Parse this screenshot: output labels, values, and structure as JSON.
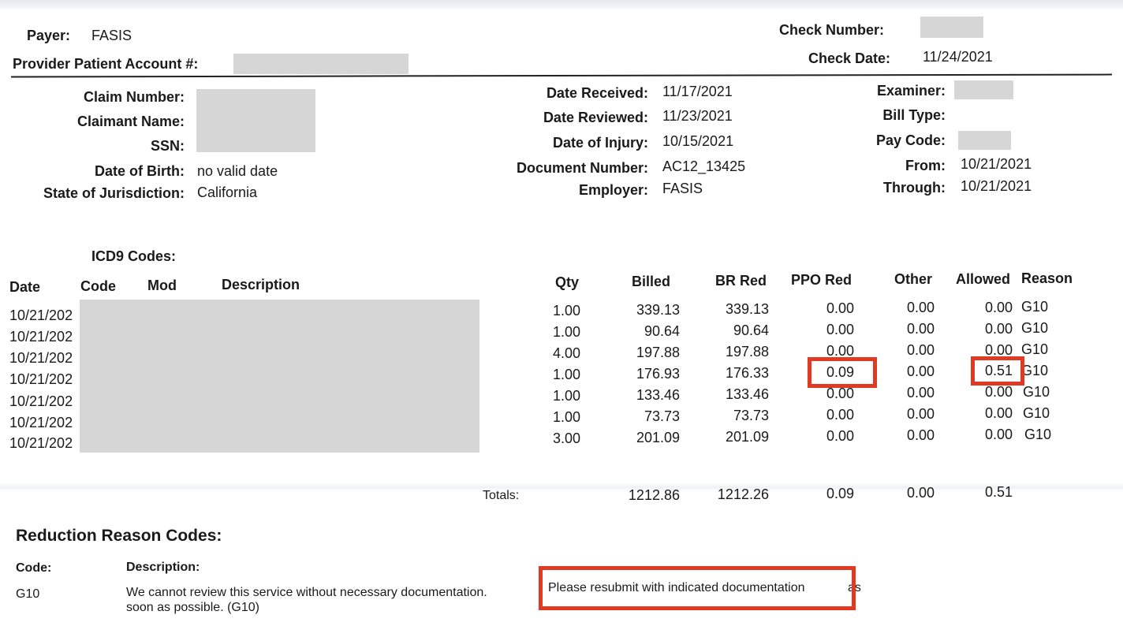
{
  "header": {
    "payer_label": "Payer:",
    "payer_value": "FASIS",
    "ppa_label": "Provider Patient Account #:",
    "check_number_label": "Check Number:",
    "check_date_label": "Check Date:",
    "check_date_value": "11/24/2021"
  },
  "claim_left": [
    {
      "label": "Claim Number:",
      "value": ""
    },
    {
      "label": "Claimant Name:",
      "value": ""
    },
    {
      "label": "SSN:",
      "value": ""
    },
    {
      "label": "Date of Birth:",
      "value": "no valid date"
    },
    {
      "label": "State of Jurisdiction:",
      "value": "California"
    }
  ],
  "claim_mid": [
    {
      "label": "Date Received:",
      "value": "11/17/2021"
    },
    {
      "label": "Date Reviewed:",
      "value": "11/23/2021"
    },
    {
      "label": "Date of Injury:",
      "value": "10/15/2021"
    },
    {
      "label": "Document Number:",
      "value": "AC12_13425"
    },
    {
      "label": "Employer:",
      "value": "FASIS"
    }
  ],
  "claim_right": [
    {
      "label": "Examiner:",
      "value": ""
    },
    {
      "label": "Bill Type:",
      "value": ""
    },
    {
      "label": "Pay Code:",
      "value": ""
    },
    {
      "label": "From:",
      "value": "10/21/2021"
    },
    {
      "label": "Through:",
      "value": "10/21/2021"
    }
  ],
  "icd_label": "ICD9 Codes:",
  "columns_left": [
    "Date",
    "Code",
    "Mod",
    "Description"
  ],
  "columns_right": [
    "Qty",
    "Billed",
    "BR Red",
    "PPO Red",
    "Other",
    "Allowed",
    "Reason"
  ],
  "rows": [
    {
      "date": "10/21/202",
      "qty": "1.00",
      "billed": "339.13",
      "br_red": "339.13",
      "ppo_red": "0.00",
      "other": "0.00",
      "allowed": "0.00",
      "reason": "G10"
    },
    {
      "date": "10/21/202",
      "qty": "1.00",
      "billed": "90.64",
      "br_red": "90.64",
      "ppo_red": "0.00",
      "other": "0.00",
      "allowed": "0.00",
      "reason": "G10"
    },
    {
      "date": "10/21/202",
      "qty": "4.00",
      "billed": "197.88",
      "br_red": "197.88",
      "ppo_red": "0.00",
      "other": "0.00",
      "allowed": "0.00",
      "reason": "G10"
    },
    {
      "date": "10/21/202",
      "qty": "1.00",
      "billed": "176.93",
      "br_red": "176.33",
      "ppo_red": "0.09",
      "other": "0.00",
      "allowed": "0.51",
      "reason": "G10"
    },
    {
      "date": "10/21/202",
      "qty": "1.00",
      "billed": "133.46",
      "br_red": "133.46",
      "ppo_red": "0.00",
      "other": "0.00",
      "allowed": "0.00",
      "reason": "G10"
    },
    {
      "date": "10/21/202",
      "qty": "1.00",
      "billed": "73.73",
      "br_red": "73.73",
      "ppo_red": "0.00",
      "other": "0.00",
      "allowed": "0.00",
      "reason": "G10"
    },
    {
      "date": "10/21/202",
      "qty": "3.00",
      "billed": "201.09",
      "br_red": "201.09",
      "ppo_red": "0.00",
      "other": "0.00",
      "allowed": "0.00",
      "reason": "G10"
    }
  ],
  "totals": {
    "label": "Totals:",
    "billed": "1212.86",
    "br_red": "1212.26",
    "ppo_red": "0.09",
    "other": "0.00",
    "allowed": "0.51"
  },
  "reasons": {
    "title": "Reduction Reason Codes:",
    "code_header": "Code:",
    "desc_header": "Description:",
    "code": "G10",
    "desc_part1": "We cannot review this service without necessary documentation.",
    "desc_highlight": "Please resubmit with indicated documentation",
    "desc_part2": "as",
    "desc_line2": "soon as possible. (G10)"
  },
  "highlight_color": "#e03a22"
}
